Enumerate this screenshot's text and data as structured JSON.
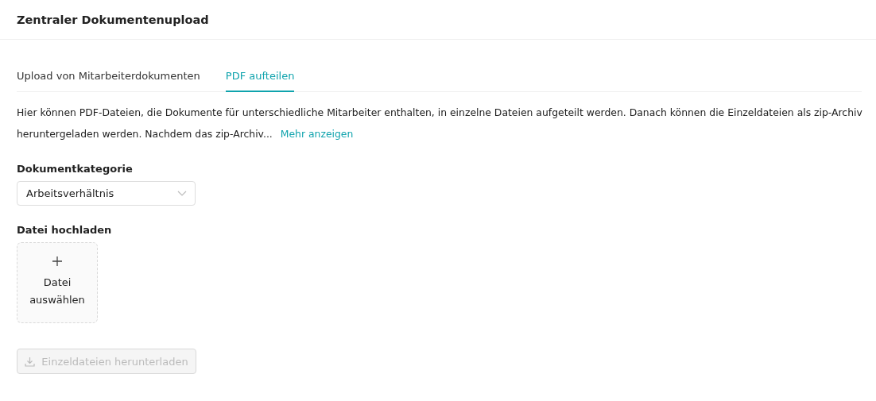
{
  "page_title": "Zentraler Dokumentenupload",
  "tabs": [
    {
      "label": "Upload von Mitarbeiterdokumenten",
      "selected": false
    },
    {
      "label": "PDF aufteilen",
      "selected": true
    }
  ],
  "description": {
    "text": "Hier können PDF-Dateien, die Dokumente für unterschiedliche Mitarbeiter enthalten, in einzelne Dateien aufgeteilt werden. Danach können die Einzeldateien als zip-Archiv heruntergeladen werden. Nachdem das zip-Archiv...",
    "link": "Mehr anzeigen"
  },
  "category": {
    "label": "Dokumentkategorie",
    "value": "Arbeitsverhältnis"
  },
  "upload": {
    "label": "Datei hochladen",
    "button": "Datei auswählen"
  },
  "download_button": {
    "label": "Einzeldateien herunterladen",
    "disabled": true
  }
}
